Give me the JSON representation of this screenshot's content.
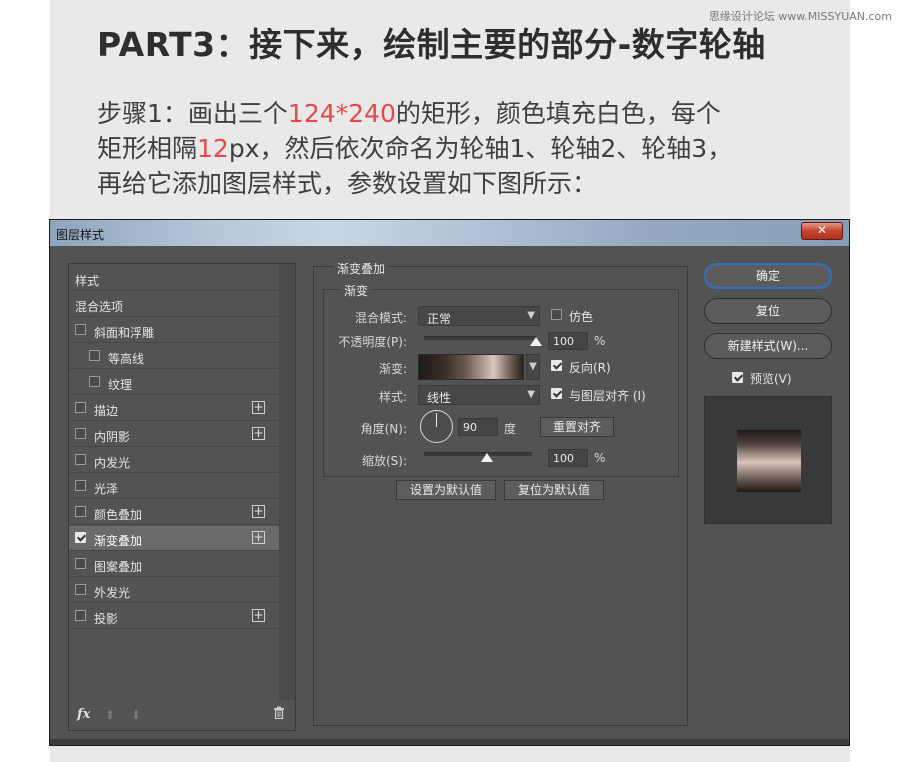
{
  "watermark": "思缘设计论坛 www.MISSYUAN.com",
  "heading": "PART3：接下来，绘制主要的部分-数字轮轴",
  "step": {
    "p1": "步骤1：画出三个",
    "num1": "124*240",
    "p2": "的矩形，颜色填充白色，每个",
    "p3": "矩形相隔",
    "num2": "12",
    "p4": "px，然后依次命名为轮轴1、轮轴2、轮轴3，",
    "p5": "再给它添加图层样式，参数设置如下图所示："
  },
  "dialog": {
    "title": "图层样式",
    "close": "✕",
    "styles_list": [
      {
        "label": "样式",
        "checkbox": false,
        "checked": false,
        "plus": false,
        "indent": 0
      },
      {
        "label": "混合选项",
        "checkbox": false,
        "checked": false,
        "plus": false,
        "indent": 0
      },
      {
        "label": "斜面和浮雕",
        "checkbox": true,
        "checked": false,
        "plus": false,
        "indent": 0
      },
      {
        "label": "等高线",
        "checkbox": true,
        "checked": false,
        "plus": false,
        "indent": 1
      },
      {
        "label": "纹理",
        "checkbox": true,
        "checked": false,
        "plus": false,
        "indent": 1
      },
      {
        "label": "描边",
        "checkbox": true,
        "checked": false,
        "plus": true,
        "indent": 0
      },
      {
        "label": "内阴影",
        "checkbox": true,
        "checked": false,
        "plus": true,
        "indent": 0
      },
      {
        "label": "内发光",
        "checkbox": true,
        "checked": false,
        "plus": false,
        "indent": 0
      },
      {
        "label": "光泽",
        "checkbox": true,
        "checked": false,
        "plus": false,
        "indent": 0
      },
      {
        "label": "颜色叠加",
        "checkbox": true,
        "checked": false,
        "plus": true,
        "indent": 0
      },
      {
        "label": "渐变叠加",
        "checkbox": true,
        "checked": true,
        "plus": true,
        "indent": 0,
        "selected": true
      },
      {
        "label": "图案叠加",
        "checkbox": true,
        "checked": false,
        "plus": false,
        "indent": 0
      },
      {
        "label": "外发光",
        "checkbox": true,
        "checked": false,
        "plus": false,
        "indent": 0
      },
      {
        "label": "投影",
        "checkbox": true,
        "checked": false,
        "plus": true,
        "indent": 0
      }
    ],
    "footer": {
      "fx": "fx",
      "up": "⬆",
      "down": "⬇",
      "trash": "🗑"
    },
    "panel": {
      "group_title": "渐变叠加",
      "subgroup_title": "渐变",
      "blend_mode_label": "混合模式:",
      "blend_mode_value": "正常",
      "dither_label": "仿色",
      "dither_checked": false,
      "opacity_label": "不透明度(P):",
      "opacity_value": "100",
      "opacity_unit": "%",
      "opacity_fraction": 1.0,
      "gradient_label": "渐变:",
      "reverse_label": "反向(R)",
      "reverse_checked": true,
      "style_label": "样式:",
      "style_value": "线性",
      "align_label": "与图层对齐 (I)",
      "align_checked": true,
      "angle_label": "角度(N):",
      "angle_value": "90",
      "angle_unit": "度",
      "reset_align": "重置对齐",
      "scale_label": "缩放(S):",
      "scale_value": "100",
      "scale_unit": "%",
      "scale_fraction": 0.58,
      "make_default": "设置为默认值",
      "reset_default": "复位为默认值"
    },
    "buttons": {
      "ok": "确定",
      "reset": "复位",
      "new_style": "新建样式(W)...",
      "preview_label": "预览(V)",
      "preview_checked": true
    }
  }
}
